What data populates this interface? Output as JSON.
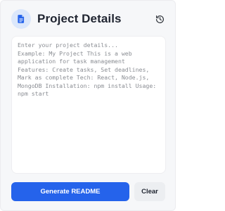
{
  "header": {
    "title": "Project Details",
    "icon": "document-icon",
    "history_icon": "history-icon"
  },
  "editor": {
    "value": "",
    "placeholder": "Enter your project details...    Example: My Project This is a web application for task management Features: Create tasks, Set deadlines, Mark as complete Tech: React, Node.js, MongoDB Installation: npm install Usage: npm start"
  },
  "actions": {
    "generate_label": "Generate README",
    "clear_label": "Clear"
  },
  "colors": {
    "accent": "#2563eb",
    "icon_badge_bg": "#dbe7fb",
    "panel_bg": "#f6f7f9"
  }
}
